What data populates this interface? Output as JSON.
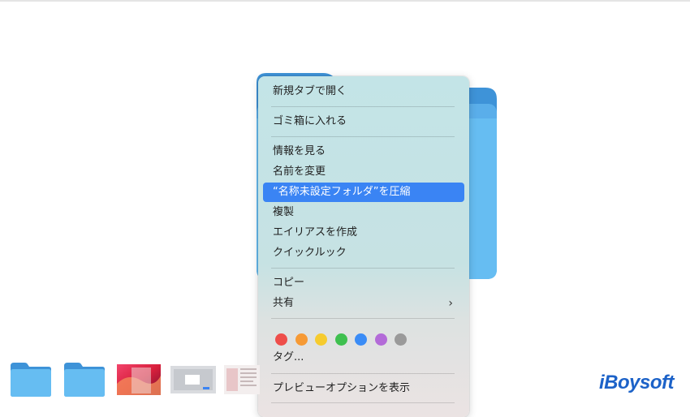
{
  "menu": {
    "items": {
      "open_new_tab": "新規タブで開く",
      "move_to_trash": "ゴミ箱に入れる",
      "get_info": "情報を見る",
      "rename": "名前を変更",
      "compress": "“名称未設定フォルダ”を圧縮",
      "duplicate": "複製",
      "make_alias": "エイリアスを作成",
      "quick_look": "クイックルック",
      "copy": "コピー",
      "share": "共有",
      "tags": "タグ...",
      "show_preview_options": "プレビューオプションを表示"
    },
    "highlighted_item": "compress",
    "tag_colors": [
      "#ee4e4a",
      "#f69a35",
      "#f6cb2e",
      "#3ec04f",
      "#3a8cf6",
      "#b36bd8",
      "#9a9a9a"
    ],
    "highlight_color": "#3a84f4"
  },
  "brand": {
    "text": "iBoysoft",
    "color": "#1c62c8"
  },
  "icons": {
    "share_chevron": "chevron-right-icon",
    "folder": "folder-icon"
  }
}
